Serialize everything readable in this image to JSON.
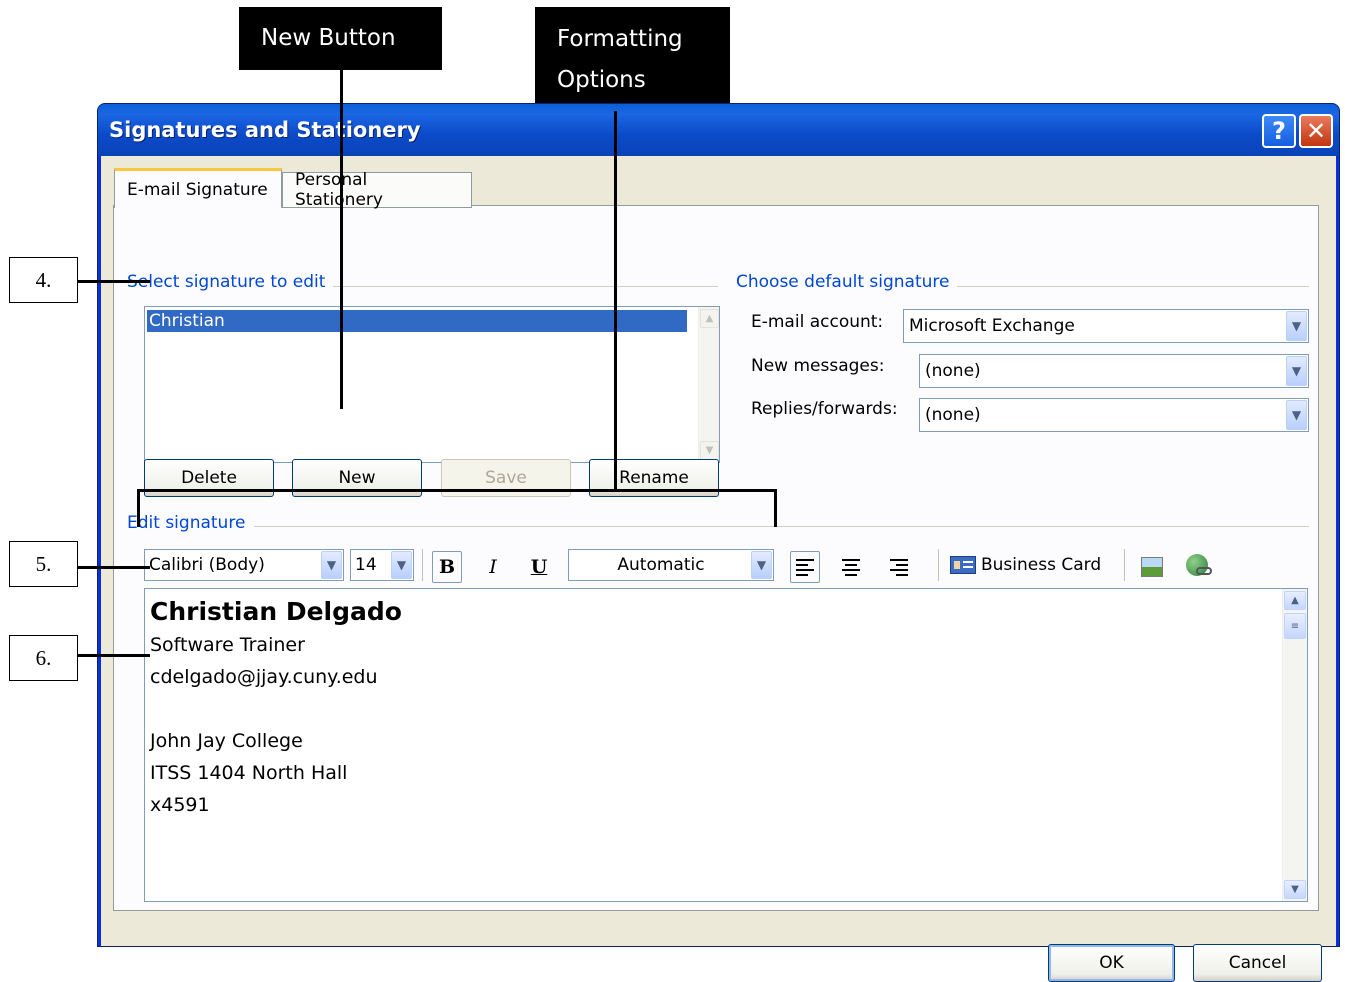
{
  "annotations": {
    "new_button_callout": "New Button",
    "formatting_callout": "Formatting Options",
    "step4": "4.",
    "step5": "5.",
    "step6": "6."
  },
  "window": {
    "title": "Signatures and Stationery",
    "help_glyph": "?",
    "close_glyph": "✕"
  },
  "tabs": [
    {
      "label": "E-mail Signature"
    },
    {
      "label": "Personal Stationery"
    }
  ],
  "select_section": {
    "label": "Select signature to edit",
    "items": [
      "Christian"
    ]
  },
  "buttons": {
    "delete": "Delete",
    "new": "New",
    "save": "Save",
    "rename": "Rename",
    "ok": "OK",
    "cancel": "Cancel"
  },
  "default_section": {
    "label": "Choose default signature",
    "email_account_label": "E-mail account:",
    "email_account_value": "Microsoft Exchange",
    "new_messages_label": "New messages:",
    "new_messages_value": "(none)",
    "replies_label": "Replies/forwards:",
    "replies_value": "(none)"
  },
  "edit_section": {
    "label": "Edit signature",
    "font": "Calibri (Body)",
    "size": "14",
    "bold": "B",
    "italic": "I",
    "underline": "U",
    "color": "Automatic",
    "business_card": "Business Card"
  },
  "signature": {
    "name": "Christian Delgado",
    "lines": [
      "Software Trainer",
      "cdelgado@jjay.cuny.edu",
      "",
      "John Jay College",
      "ITSS 1404 North Hall",
      "x4591"
    ]
  },
  "colors": {
    "titlebar": "#0a5fd8",
    "selection": "#316ac5",
    "group_label": "#0046d5"
  }
}
